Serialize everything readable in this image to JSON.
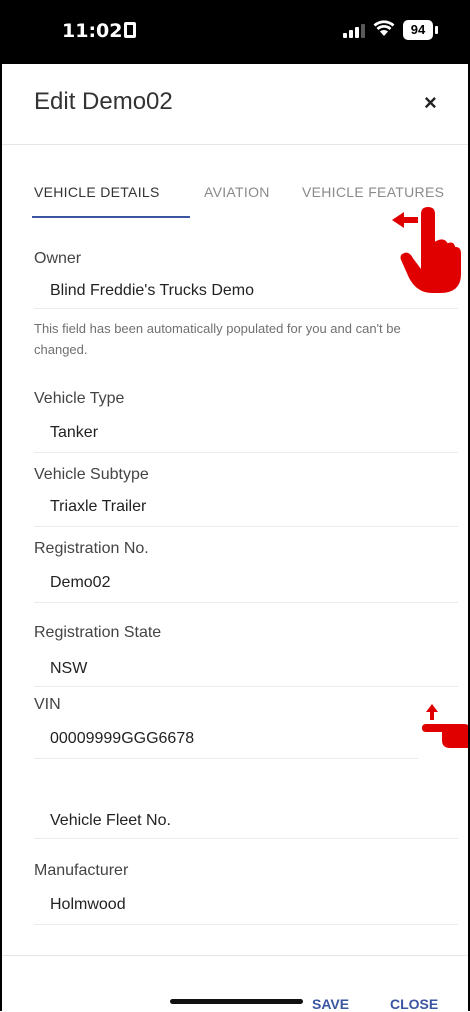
{
  "status_bar": {
    "time": "11:02",
    "battery": "94"
  },
  "header": {
    "title": "Edit Demo02",
    "close_symbol": "×"
  },
  "tabs": [
    {
      "label": "VEHICLE DETAILS",
      "active": true
    },
    {
      "label": "AVIATION",
      "active": false
    },
    {
      "label": "VEHICLE FEATURES",
      "active": false
    }
  ],
  "form": {
    "owner": {
      "label": "Owner",
      "value": "Blind Freddie's Trucks Demo",
      "helper": "This field has been automatically populated for you and can't be changed."
    },
    "vehicle_type": {
      "label": "Vehicle Type",
      "value": "Tanker"
    },
    "vehicle_subtype": {
      "label": "Vehicle Subtype",
      "value": "Triaxle Trailer"
    },
    "registration_no": {
      "label": "Registration No.",
      "value": "Demo02"
    },
    "registration_state": {
      "label": "Registration State",
      "value": "NSW"
    },
    "vin": {
      "label": "VIN",
      "value": "00009999GGG6678"
    },
    "fleet_no": {
      "placeholder": "Vehicle Fleet No."
    },
    "manufacturer": {
      "label": "Manufacturer",
      "value": "Holmwood"
    }
  },
  "footer": {
    "save": "SAVE",
    "close": "CLOSE"
  },
  "colors": {
    "accent": "#3b55a0",
    "annotation": "#e10000",
    "status_bar": "#000000"
  }
}
